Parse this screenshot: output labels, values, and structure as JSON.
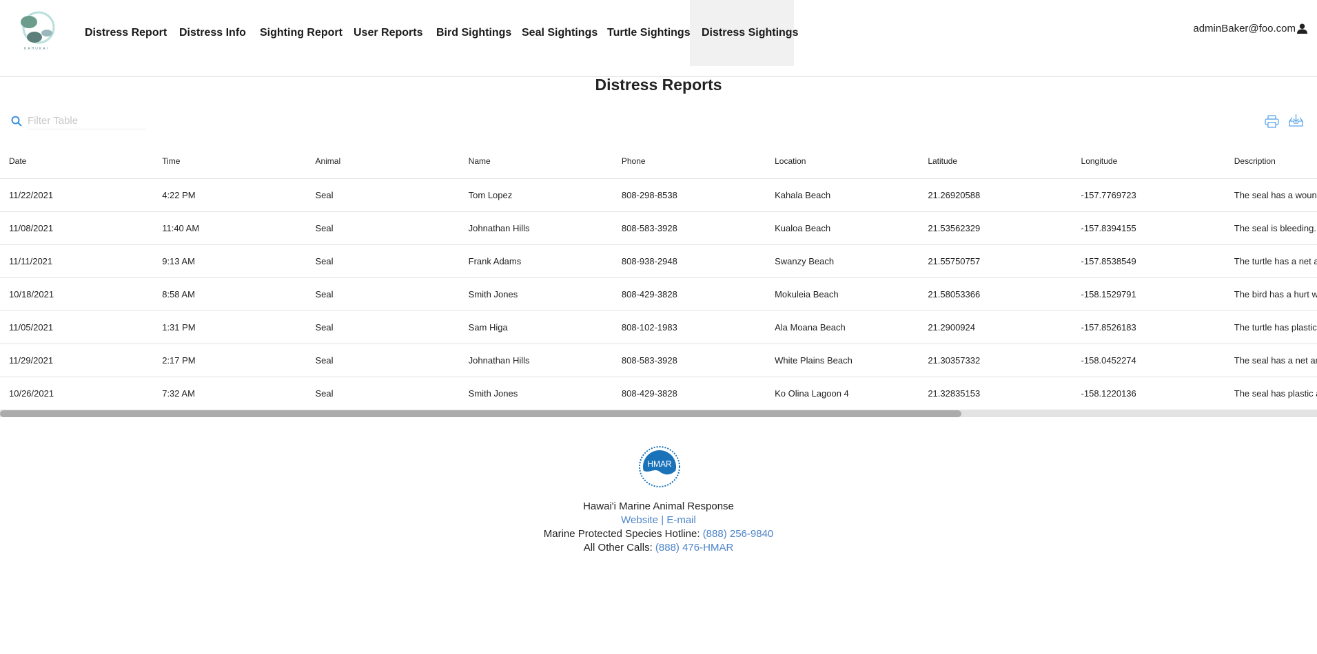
{
  "brand": {
    "logo_text": "KAHUKAI"
  },
  "nav": [
    "Distress Report",
    "Distress Info",
    "Sighting Report",
    "User Reports",
    "Bird Sightings",
    "Seal Sightings",
    "Turtle Sightings",
    "Distress Sightings"
  ],
  "active_nav": "Distress Sightings",
  "user": {
    "email": "adminBaker@foo.com"
  },
  "page": {
    "title": "Distress Reports",
    "filter_placeholder": "Filter Table"
  },
  "table": {
    "columns": [
      "Date",
      "Time",
      "Animal",
      "Name",
      "Phone",
      "Location",
      "Latitude",
      "Longitude",
      "Description"
    ],
    "rows": [
      [
        "11/22/2021",
        "4:22 PM",
        "Seal",
        "Tom Lopez",
        "808-298-8538",
        "Kahala Beach",
        "21.26920588",
        "-157.7769723",
        "The seal has a wound."
      ],
      [
        "11/08/2021",
        "11:40 AM",
        "Seal",
        "Johnathan Hills",
        "808-583-3928",
        "Kualoa Beach",
        "21.53562329",
        "-157.8394155",
        "The seal is bleeding."
      ],
      [
        "11/11/2021",
        "9:13 AM",
        "Seal",
        "Frank Adams",
        "808-938-2948",
        "Swanzy Beach",
        "21.55750757",
        "-157.8538549",
        "The turtle has a net arou"
      ],
      [
        "10/18/2021",
        "8:58 AM",
        "Seal",
        "Smith Jones",
        "808-429-3828",
        "Mokuleia Beach",
        "21.58053366",
        "-158.1529791",
        "The bird has a hurt wing"
      ],
      [
        "11/05/2021",
        "1:31 PM",
        "Seal",
        "Sam Higa",
        "808-102-1983",
        "Ala Moana Beach",
        "21.2900924",
        "-157.8526183",
        "The turtle has plastic ar"
      ],
      [
        "11/29/2021",
        "2:17 PM",
        "Seal",
        "Johnathan Hills",
        "808-583-3928",
        "White Plains Beach",
        "21.30357332",
        "-158.0452274",
        "The seal has a net aroun"
      ],
      [
        "10/26/2021",
        "7:32 AM",
        "Seal",
        "Smith Jones",
        "808-429-3828",
        "Ko Olina Lagoon 4",
        "21.32835153",
        "-158.1220136",
        "The seal has plastic arou"
      ]
    ]
  },
  "scroll": {
    "horizontal_position": 0,
    "visible_fraction": 0.73
  },
  "footer": {
    "logo_text": "HMAR",
    "org": "Hawai'i Marine Animal Response",
    "website": "Website",
    "sep": "|",
    "email": "E-mail",
    "hotline_label": "Marine Protected Species Hotline:",
    "hotline": "(888) 256-9840",
    "other_label": "All Other Calls:",
    "other": "(888) 476-HMAR"
  },
  "colors": {
    "accent": "#4d84c8",
    "icon": "#3b8fe0",
    "active_tab_bg": "#f1f1f1",
    "hmar_blue": "#1a72b9"
  }
}
